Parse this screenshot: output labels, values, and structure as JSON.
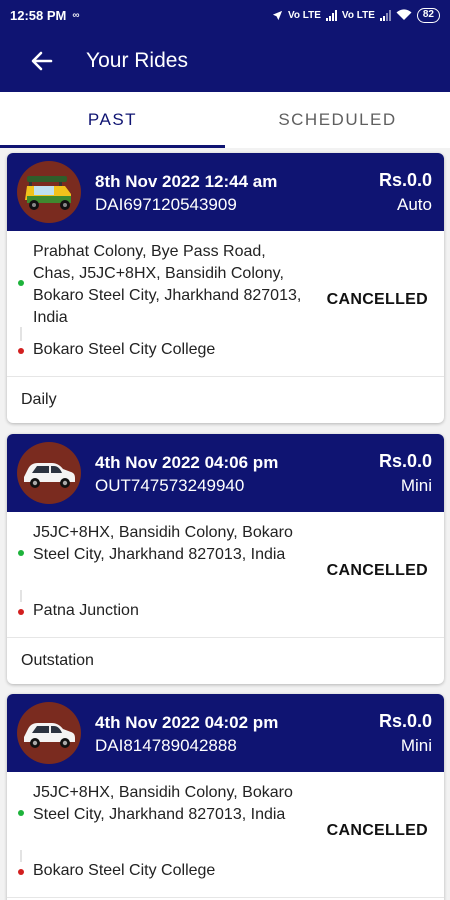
{
  "status_bar": {
    "time": "12:58 PM",
    "extra": "∞",
    "net1": "Vo LTE",
    "net2": "Vo LTE",
    "battery": "82"
  },
  "app_bar": {
    "title": "Your Rides"
  },
  "tabs": [
    {
      "label": "PAST",
      "active": true
    },
    {
      "label": "SCHEDULED",
      "active": false
    }
  ],
  "rides": [
    {
      "vehicle_icon": "auto-rickshaw-icon",
      "datetime": "8th Nov 2022 12:44 am",
      "booking_id": "DAI697120543909",
      "fare": "Rs.0.0",
      "vehicle_type": "Auto",
      "pickup": "Prabhat Colony, Bye Pass Road, Chas, J5JC+8HX, Bansidih Colony, Bokaro Steel City, Jharkhand 827013, India",
      "drop": "Bokaro Steel City College",
      "status": "CANCELLED",
      "trip_type": "Daily"
    },
    {
      "vehicle_icon": "car-icon",
      "datetime": "4th Nov 2022 04:06 pm",
      "booking_id": "OUT747573249940",
      "fare": "Rs.0.0",
      "vehicle_type": "Mini",
      "pickup": "J5JC+8HX, Bansidih Colony, Bokaro Steel City, Jharkhand 827013, India",
      "drop": "Patna Junction",
      "status": "CANCELLED",
      "trip_type": "Outstation"
    },
    {
      "vehicle_icon": "car-icon",
      "datetime": "4th Nov 2022 04:02 pm",
      "booking_id": "DAI814789042888",
      "fare": "Rs.0.0",
      "vehicle_type": "Mini",
      "pickup": "J5JC+8HX, Bansidih Colony, Bokaro Steel City, Jharkhand 827013, India",
      "drop": "Bokaro Steel City College",
      "status": "CANCELLED",
      "trip_type": ""
    }
  ],
  "colors": {
    "primary": "#0f1472",
    "pickup_dot": "#1db33b",
    "drop_dot": "#d21f1f",
    "vehicle_bg": "#7a2b1f"
  }
}
